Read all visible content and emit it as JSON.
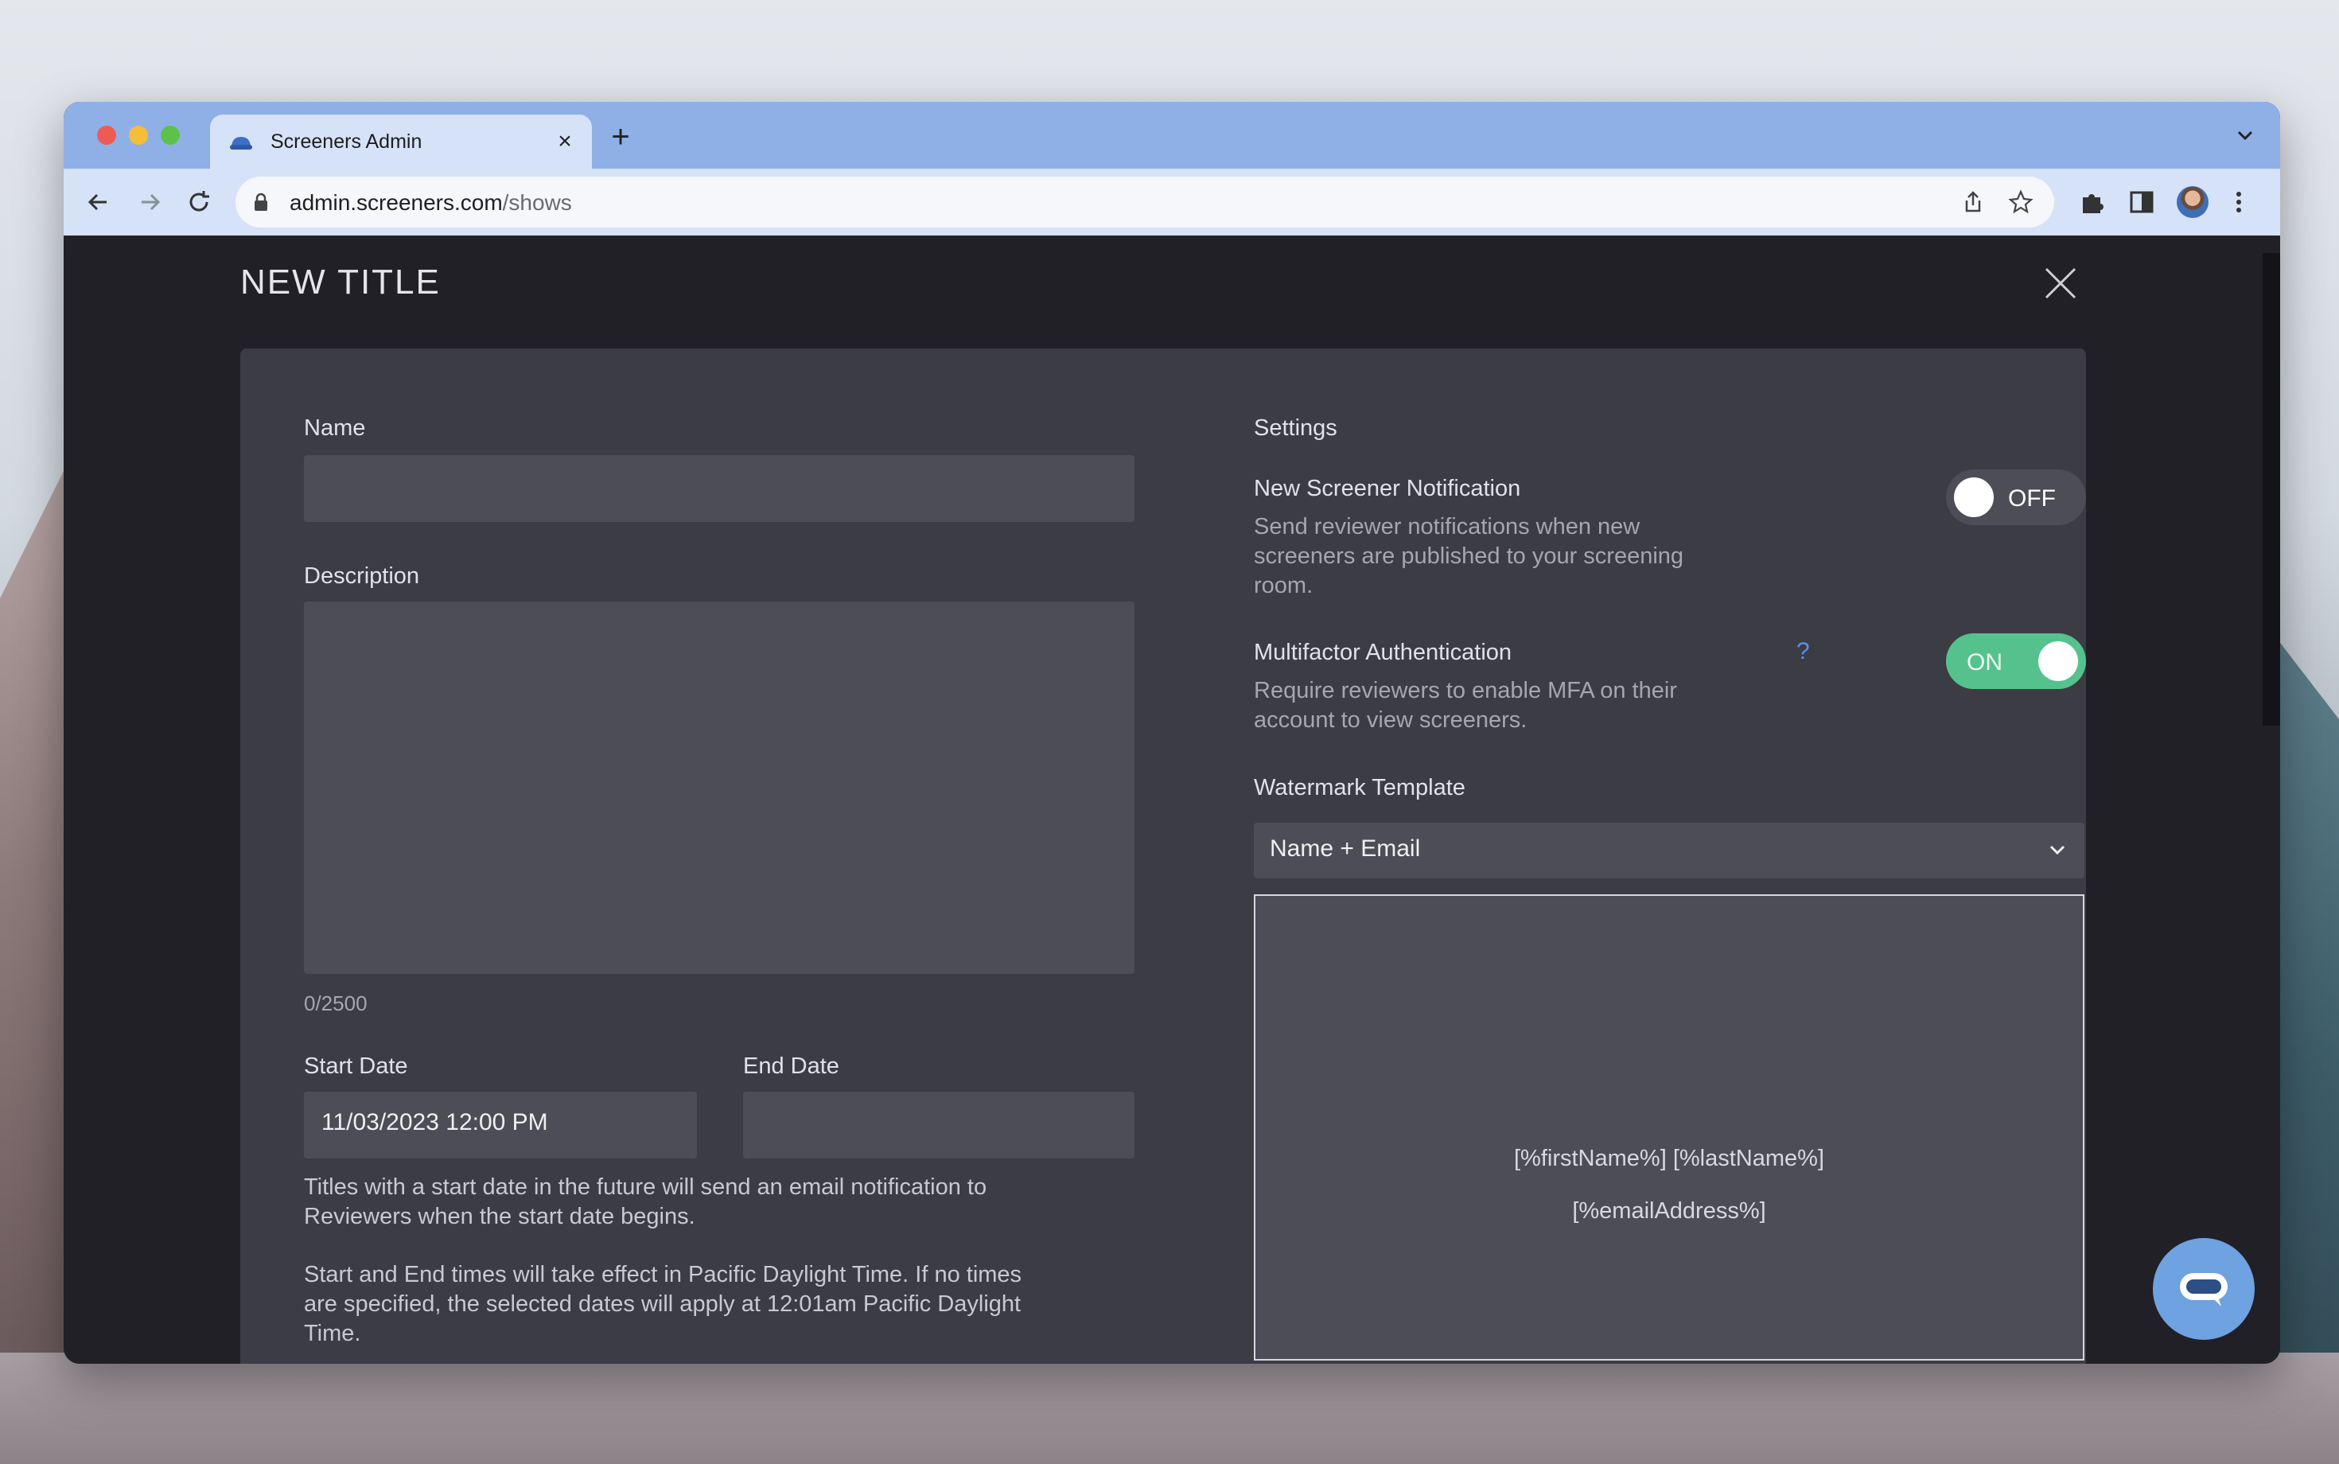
{
  "browser": {
    "tab_title": "Screeners Admin",
    "new_tab_label": "+",
    "tab_close_label": "×",
    "url_domain": "admin.screeners.com",
    "url_path": "/shows"
  },
  "modal": {
    "title": "NEW TITLE"
  },
  "form": {
    "name_label": "Name",
    "name_value": "",
    "description_label": "Description",
    "description_value": "",
    "char_count": "0/2500",
    "start_date_label": "Start Date",
    "start_date_value": "11/03/2023 12:00 PM",
    "end_date_label": "End Date",
    "end_date_value": "",
    "help_line1": "Titles with a start date in the future will send an email notification to",
    "help_line2": "Reviewers when the start date begins.",
    "help_line3": "Start and End times will take effect in Pacific Daylight Time. If no times",
    "help_line4": "are specified, the selected dates will apply at 12:01am Pacific Daylight",
    "help_line5": "Time."
  },
  "settings": {
    "heading": "Settings",
    "notification": {
      "title": "New Screener Notification",
      "desc_line1": "Send reviewer notifications when new",
      "desc_line2": "screeners are published to your screening",
      "desc_line3": "room.",
      "toggle_label": "OFF"
    },
    "mfa": {
      "title": "Multifactor Authentication",
      "help_label": "?",
      "desc_line1": "Require reviewers to enable MFA on their",
      "desc_line2": "account to view screeners.",
      "toggle_label": "ON"
    },
    "watermark": {
      "label": "Watermark Template",
      "selected": "Name + Email",
      "preview_line1": "[%firstName%] [%lastName%]",
      "preview_line2": "[%emailAddress%]"
    }
  },
  "colors": {
    "accent_on": "#55c28e",
    "panel_bg": "#3b3c44",
    "field_bg": "#4c4d56",
    "tabbar": "#8fb0e6",
    "chat_button": "#6ea2e0",
    "help_link": "#5b8ff0"
  },
  "icons": [
    "tab-favicon-icon",
    "close-icon",
    "plus-icon",
    "chevron-down-icon",
    "back-arrow-icon",
    "forward-arrow-icon",
    "reload-icon",
    "lock-icon",
    "share-icon",
    "star-icon",
    "extensions-icon",
    "sidepanel-icon",
    "avatar",
    "kebab-menu-icon",
    "chat-icon"
  ]
}
